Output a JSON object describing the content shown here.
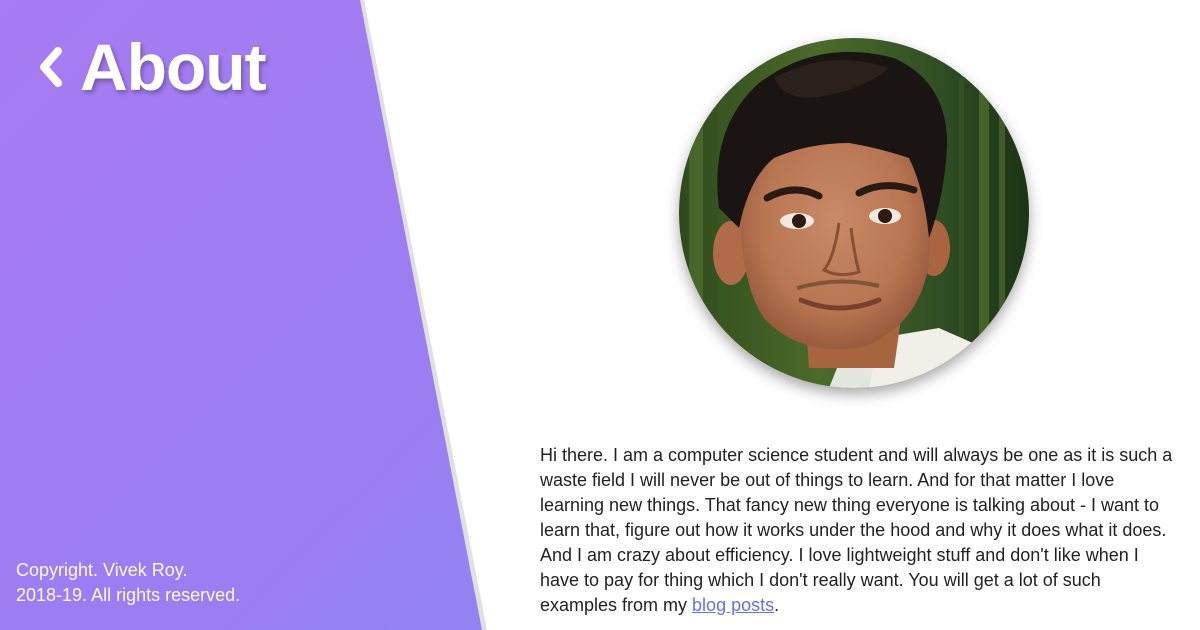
{
  "header": {
    "title": "About",
    "back_icon": "chevron-left-icon"
  },
  "footer": {
    "copyright_line1": "Copyright. Vivek Roy.",
    "copyright_line2": "2018-19. All rights reserved."
  },
  "profile": {
    "avatar_icon": "profile-photo"
  },
  "bio": {
    "text": "Hi there. I am a computer science student and will always be one as it is such a waste field I will never be out of things to learn. And for that matter I love learning new things. That fancy new thing everyone is talking about - I want to learn that, figure out how it works under the hood and why it does what it does. And I am crazy about efficiency. I love lightweight stuff and don't like when I have to pay for thing which I don't really want. You will get a lot of such examples from my ",
    "link_label": "blog posts",
    "suffix": "."
  },
  "colors": {
    "gradient_start": "#a77bf1",
    "gradient_end": "#7a92f7",
    "link": "#6c6cf0",
    "text": "#222222"
  }
}
